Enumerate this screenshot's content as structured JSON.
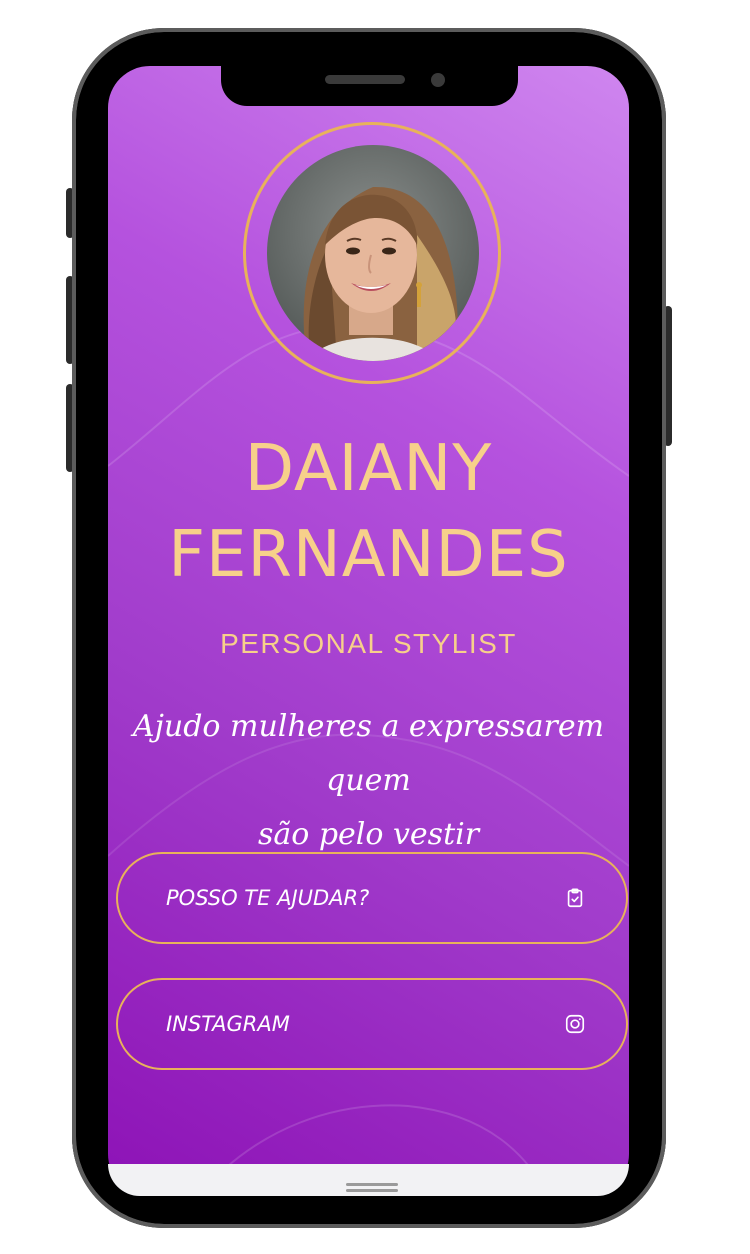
{
  "profile": {
    "name_line1": "DAIANY",
    "name_line2": "FERNANDES",
    "role": "PERSONAL STYLIST",
    "tagline_line1": "Ajudo mulheres a expressarem quem",
    "tagline_line2": "são pelo vestir"
  },
  "links": [
    {
      "label": "POSSO TE AJUDAR?",
      "icon": "clipboard-check-icon"
    },
    {
      "label": "INSTAGRAM",
      "icon": "instagram-icon"
    }
  ],
  "colors": {
    "accent_gold": "#e8b25a",
    "title_gold": "#f7d08a",
    "gradient_light": "#cf86ef",
    "gradient_dark": "#8d12b6"
  }
}
